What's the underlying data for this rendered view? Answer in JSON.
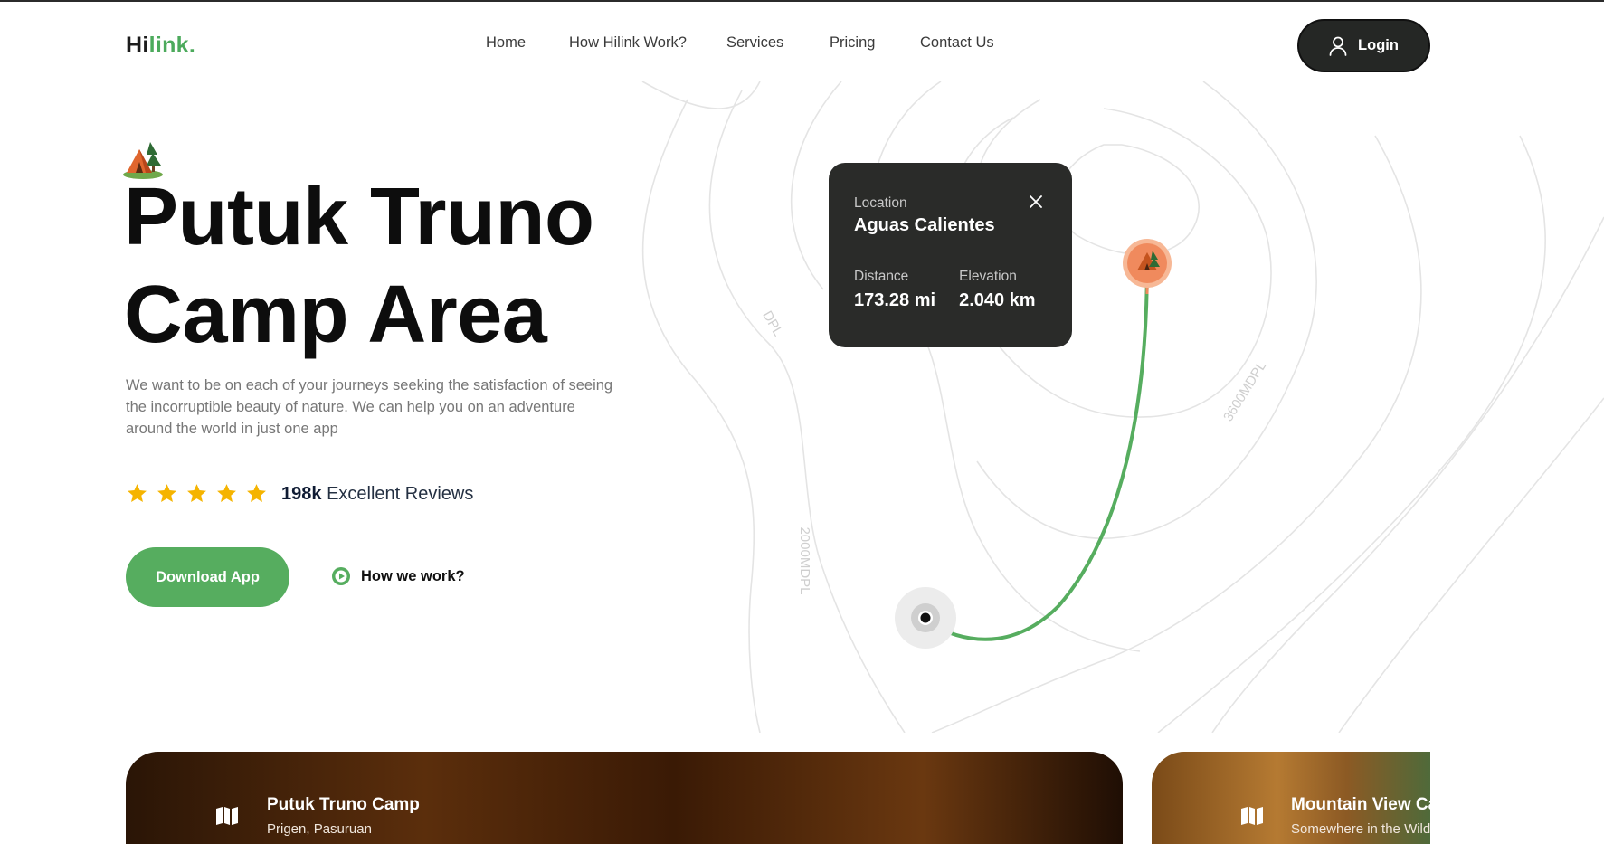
{
  "brand": {
    "logo_dark": "Hi",
    "logo_accent": "link.",
    "accent_color": "#4caa5c"
  },
  "nav": {
    "items": [
      {
        "label": "Home"
      },
      {
        "label": "How Hilink Work?"
      },
      {
        "label": "Services"
      },
      {
        "label": "Pricing"
      },
      {
        "label": "Contact Us"
      }
    ],
    "login_label": "Login"
  },
  "hero": {
    "title_line1": "Putuk Truno",
    "title_line2": "Camp Area",
    "description": "We want to be on each of your journeys seeking the satisfaction of seeing the incorruptible beauty of nature. We can help you on an adventure around the world in just one app",
    "rating": {
      "stars": 5,
      "count": "198k",
      "label": "Excellent Reviews"
    },
    "download_label": "Download App",
    "how_label": "How we work?"
  },
  "map": {
    "contour_labels": [
      "2000MDPL",
      "3600MDPL",
      "DPL"
    ],
    "location_label": "Location",
    "location_name": "Aguas Calientes",
    "distance_label": "Distance",
    "distance_value": "173.28 mi",
    "elevation_label": "Elevation",
    "elevation_value": "2.040 km",
    "route_color": "#56ad5f",
    "pin_color": "#f08a5d"
  },
  "cards": [
    {
      "title": "Putuk Truno Camp",
      "subtitle": "Prigen, Pasuruan",
      "icon": "map-icon"
    },
    {
      "title": "Mountain View Camp",
      "subtitle": "Somewhere in the Wilderness",
      "icon": "map-icon"
    }
  ]
}
